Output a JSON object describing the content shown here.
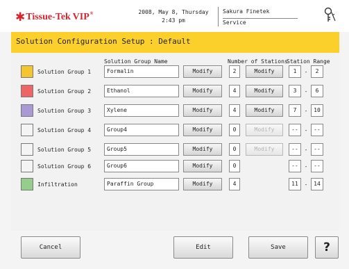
{
  "header": {
    "brand": "Tissue-Tek",
    "brand_model": "VIP",
    "brand_mark": "®",
    "date": "2008, May 8, Thursday",
    "time": "2:43 pm",
    "company": "Sakura Finetek",
    "user": "Service",
    "key_icon": "key-icon"
  },
  "title": "Solution Configuration Setup : Default",
  "columns": {
    "name": "Solution Group Name",
    "stations": "Number of Stations",
    "range": "Station Range"
  },
  "groups": [
    {
      "label": "Solution Group 1",
      "color": "#f5c530",
      "name": "Formalin",
      "modify": "Modify",
      "stations": "2",
      "stations_modify": "Modify",
      "stations_modify_enabled": true,
      "range_from": "1",
      "range_sep": "-",
      "range_to": "2"
    },
    {
      "label": "Solution Group 2",
      "color": "#ef6464",
      "name": "Ethanol",
      "modify": "Modify",
      "stations": "4",
      "stations_modify": "Modify",
      "stations_modify_enabled": true,
      "range_from": "3",
      "range_sep": "-",
      "range_to": "6"
    },
    {
      "label": "Solution Group 3",
      "color": "#a99ad6",
      "name": "Xylene",
      "modify": "Modify",
      "stations": "4",
      "stations_modify": "Modify",
      "stations_modify_enabled": true,
      "range_from": "7",
      "range_sep": "-",
      "range_to": "10"
    },
    {
      "label": "Solution Group 4",
      "color": "#f4f4f4",
      "name": "Group4",
      "modify": "Modify",
      "stations": "0",
      "stations_modify": "Modify",
      "stations_modify_enabled": false,
      "range_from": "--",
      "range_sep": "-",
      "range_to": "--"
    },
    {
      "label": "Solution Group 5",
      "color": "#f4f4f4",
      "name": "Group5",
      "modify": "Modify",
      "stations": "0",
      "stations_modify": "Modify",
      "stations_modify_enabled": false,
      "range_from": "--",
      "range_sep": "-",
      "range_to": "--"
    },
    {
      "label": "Solution Group 6",
      "color": "#f4f4f4",
      "name": "Group6",
      "modify": "Modify",
      "stations": "0",
      "stations_modify": null,
      "stations_modify_enabled": false,
      "range_from": "--",
      "range_sep": "-",
      "range_to": "--"
    },
    {
      "label": "Infiltration",
      "color": "#93cf89",
      "name": "Paraffin Group",
      "modify": "Modify",
      "stations": "4",
      "stations_modify": null,
      "stations_modify_enabled": false,
      "range_from": "11",
      "range_sep": "-",
      "range_to": "14"
    }
  ],
  "footer": {
    "cancel": "Cancel",
    "edit": "Edit",
    "save": "Save",
    "help": "?"
  }
}
